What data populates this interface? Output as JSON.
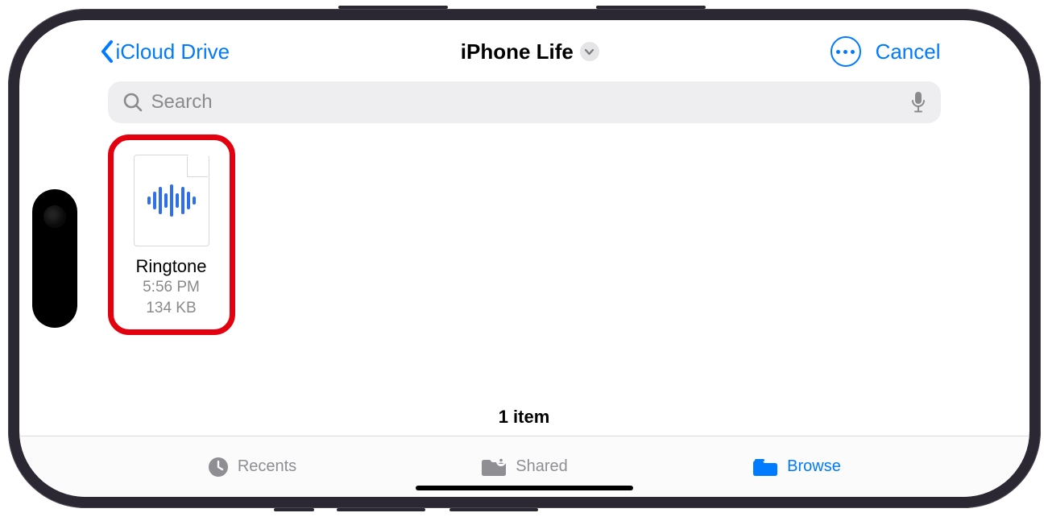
{
  "nav": {
    "back_label": "iCloud Drive",
    "title": "iPhone Life",
    "cancel_label": "Cancel"
  },
  "search": {
    "placeholder": "Search"
  },
  "files": {
    "items": [
      {
        "name": "Ringtone",
        "time": "5:56 PM",
        "size": "134 KB"
      }
    ],
    "count_label": "1 item"
  },
  "tabs": {
    "recents": "Recents",
    "shared": "Shared",
    "browse": "Browse"
  }
}
